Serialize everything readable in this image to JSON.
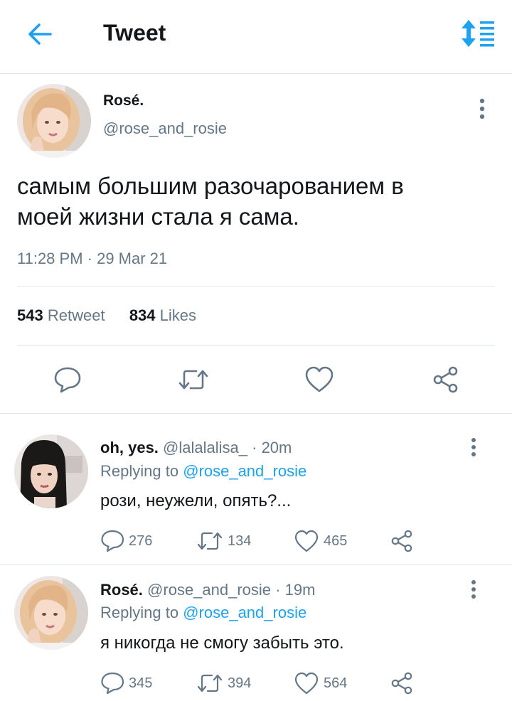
{
  "header": {
    "title": "Tweet",
    "back_icon": "arrow-left-icon",
    "sort_icon": "sort-list-icon",
    "accent_color": "#1da1f2"
  },
  "main_tweet": {
    "author_name": "Rosé.",
    "author_handle": "@rose_and_rosie",
    "text_line1": "самым большим разочарованием в",
    "text_line2": "моей жизни стала я сама.",
    "timestamp": "11:28 PM · 29 Mar 21",
    "retweet_count": "543",
    "retweet_label": "Retweet",
    "likes_count": "834",
    "likes_label": "Likes"
  },
  "replies": [
    {
      "author_name": "oh, yes.",
      "author_handle": "@lalalalisa_",
      "time": "· 20m",
      "replying_prefix": "Replying to",
      "replying_to": "@rose_and_rosie",
      "text": "рози, неужели, опять?...",
      "reply_count": "276",
      "retweet_count": "134",
      "like_count": "465"
    },
    {
      "author_name": "Rosé.",
      "author_handle": "@rose_and_rosie",
      "time": "· 19m",
      "replying_prefix": "Replying to",
      "replying_to": "@rose_and_rosie",
      "text": "я никогда не смогу забыть это.",
      "reply_count": "345",
      "retweet_count": "394",
      "like_count": "564"
    }
  ]
}
